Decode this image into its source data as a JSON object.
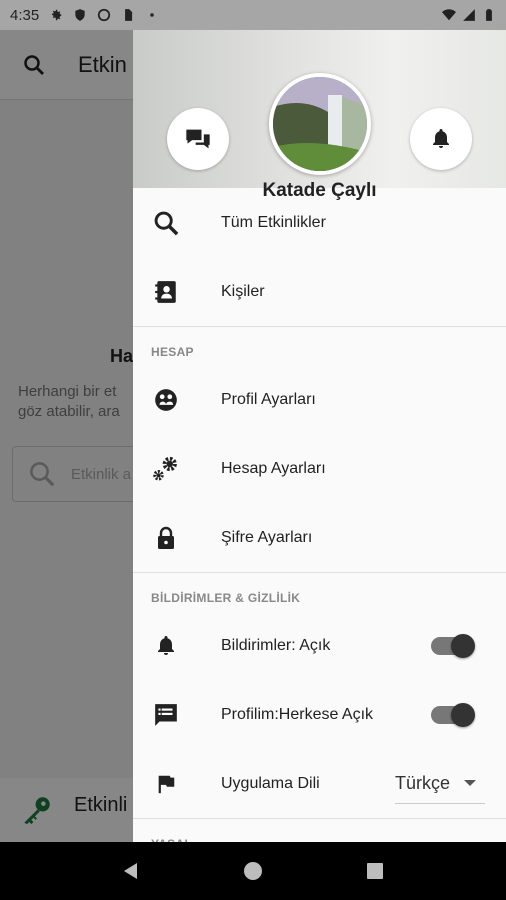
{
  "status_bar": {
    "time": "4:35",
    "icons": [
      "gear-icon",
      "shield-icon",
      "circle-icon",
      "sim-icon",
      "dot-icon"
    ],
    "right_icons": [
      "wifi-icon",
      "signal-icon",
      "battery-icon"
    ]
  },
  "background": {
    "appbar_title": "Etkin",
    "empty_title": "Ha",
    "empty_text_line1": "Herhangi bir et",
    "empty_text_line2": "göz atabilir, ara",
    "search_placeholder": "Etkinlik a",
    "bottom_label": "Etkinli"
  },
  "drawer": {
    "user_name": "Katade Çaylı",
    "menu_top": [
      {
        "label": "Tüm Etkinlikler",
        "icon": "search-icon"
      },
      {
        "label": "Kişiler",
        "icon": "contacts-icon"
      }
    ],
    "section_account": "HESAP",
    "menu_account": [
      {
        "label": "Profil Ayarları",
        "icon": "profile-settings-icon"
      },
      {
        "label": "Hesap Ayarları",
        "icon": "gears-icon"
      },
      {
        "label": "Şifre Ayarları",
        "icon": "lock-icon"
      }
    ],
    "section_notifications": "BİLDİRİMLER & GİZLİLİK",
    "notifications_label": "Bildirimler: Açık",
    "notifications_on": true,
    "profile_public_label": "Profilim:Herkese Açık",
    "profile_public_on": true,
    "language_label": "Uygulama Dili",
    "language_value": "Türkçe",
    "section_legal": "YASAL"
  }
}
